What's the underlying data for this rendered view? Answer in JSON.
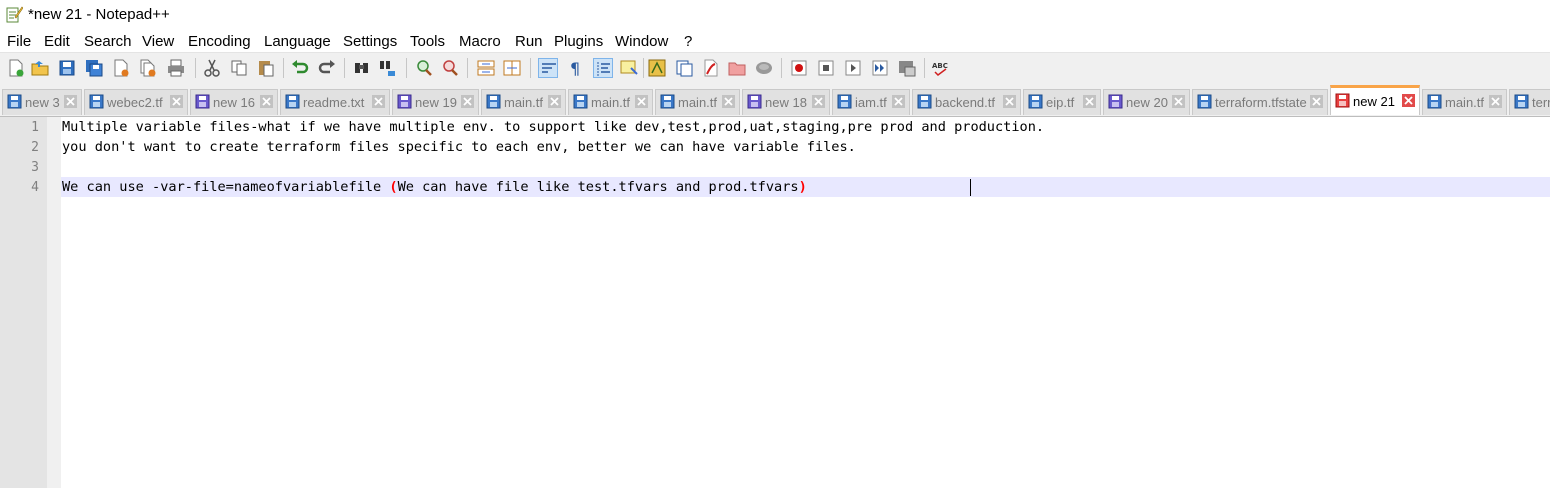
{
  "window": {
    "title": "*new 21 - Notepad++"
  },
  "menu": [
    "File",
    "Edit",
    "Search",
    "View",
    "Encoding",
    "Language",
    "Settings",
    "Tools",
    "Macro",
    "Run",
    "Plugins",
    "Window",
    "?"
  ],
  "toolbar_icons": [
    "new-file-icon",
    "open-file-icon",
    "save-icon",
    "save-all-icon",
    "close-icon",
    "close-all-icon",
    "print-icon",
    "cut-icon",
    "copy-icon",
    "paste-icon",
    "undo-icon",
    "redo-icon",
    "find-icon",
    "replace-icon",
    "zoom-in-icon",
    "zoom-out-icon",
    "sync-vertical-icon",
    "sync-horizontal-icon",
    "word-wrap-icon",
    "show-all-chars-icon",
    "indent-guide-icon",
    "doc-map-icon",
    "language-icon",
    "function-list-icon",
    "pdf-icon",
    "folder-icon",
    "monitor-icon",
    "record-macro-icon",
    "stop-record-icon",
    "play-macro-icon",
    "run-macro-multiple-icon",
    "save-macro-icon",
    "spellcheck-icon"
  ],
  "tabs": [
    {
      "label": "new 3",
      "active": false
    },
    {
      "label": "webec2.tf",
      "active": false
    },
    {
      "label": "new 16",
      "active": false
    },
    {
      "label": "readme.txt",
      "active": false
    },
    {
      "label": "new 19",
      "active": false
    },
    {
      "label": "main.tf",
      "active": false
    },
    {
      "label": "main.tf",
      "active": false
    },
    {
      "label": "main.tf",
      "active": false
    },
    {
      "label": "new 18",
      "active": false
    },
    {
      "label": "iam.tf",
      "active": false
    },
    {
      "label": "backend.tf",
      "active": false
    },
    {
      "label": "eip.tf",
      "active": false
    },
    {
      "label": "new 20",
      "active": false
    },
    {
      "label": "terraform.tfstate",
      "active": false
    },
    {
      "label": "new 21",
      "active": true
    },
    {
      "label": "main.tf",
      "active": false
    },
    {
      "label": "terr",
      "active": false
    }
  ],
  "editor": {
    "line_numbers": [
      "1",
      "2",
      "3",
      "4"
    ],
    "lines": [
      "Multiple variable files-what if we have multiple env. to support like dev,test,prod,uat,staging,pre prod and production.",
      "you don't want to create terraform files specific to each env, better we can have variable files.",
      "",
      "We can use -var-file=nameofvariablefile "
    ],
    "line4_paren_open": "(",
    "line4_paren_inner": "We can have file like test.tfvars and prod.tfvars",
    "line4_paren_close": ")"
  },
  "colors": {
    "active_tab_accent": "#f9a448",
    "current_line": "#e8e8ff",
    "brace_highlight": "#ff0000"
  }
}
